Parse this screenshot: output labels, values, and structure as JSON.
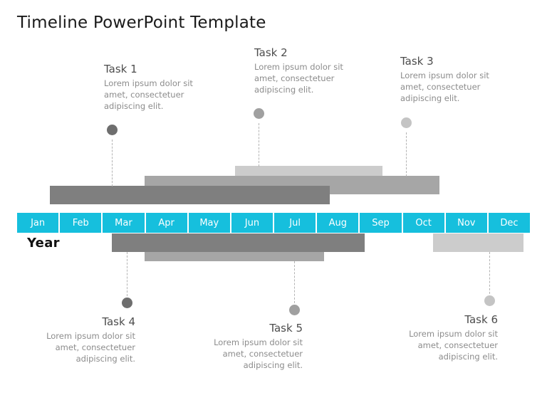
{
  "slide": {
    "title": "Timeline PowerPoint Template",
    "year_label": "Year",
    "background_color": "#ffffff"
  },
  "palette": {
    "accent": "#16bfdd",
    "bar_dark": "#7f7f7f",
    "bar_medium": "#a6a6a6",
    "bar_light": "#cccccc",
    "title_text": "#1a1a1a",
    "task_title_text": "#4d4d4d",
    "task_desc_text": "#8c8c8c",
    "connector": "#b3b3b3"
  },
  "timeline": {
    "months": [
      "Jan",
      "Feb",
      "Mar",
      "Apr",
      "May",
      "Jun",
      "Jul",
      "Aug",
      "Sep",
      "Oct",
      "Nov",
      "Dec"
    ]
  },
  "tasks": [
    {
      "id": "task-1",
      "title": "Task 1",
      "description": "Lorem ipsum dolor sit amet, consectetuer adipiscing elit.",
      "side": "above",
      "align": "left",
      "marker_color": "#6e6e6e"
    },
    {
      "id": "task-2",
      "title": "Task 2",
      "description": "Lorem ipsum dolor sit amet, consectetuer adipiscing elit.",
      "side": "above",
      "align": "left",
      "marker_color": "#a0a0a0"
    },
    {
      "id": "task-3",
      "title": "Task 3",
      "description": "Lorem ipsum dolor sit amet, consectetuer adipiscing elit.",
      "side": "above",
      "align": "left",
      "marker_color": "#c4c4c4"
    },
    {
      "id": "task-4",
      "title": "Task 4",
      "description": "Lorem ipsum dolor sit amet, consectetuer adipiscing elit.",
      "side": "below",
      "align": "right",
      "marker_color": "#6e6e6e"
    },
    {
      "id": "task-5",
      "title": "Task 5",
      "description": "Lorem ipsum dolor sit amet, consectetuer adipiscing elit.",
      "side": "below",
      "align": "right",
      "marker_color": "#a0a0a0"
    },
    {
      "id": "task-6",
      "title": "Task 6",
      "description": "Lorem ipsum dolor sit amet, consectetuer adipiscing elit.",
      "side": "below",
      "align": "right",
      "marker_color": "#c4c4c4"
    }
  ],
  "chart_data": {
    "type": "bar",
    "title": "Timeline PowerPoint Template",
    "xlabel": "Year",
    "ylabel": "",
    "categories": [
      "Jan",
      "Feb",
      "Mar",
      "Apr",
      "May",
      "Jun",
      "Jul",
      "Aug",
      "Sep",
      "Oct",
      "Nov",
      "Dec"
    ],
    "orientation": "horizontal",
    "grid": false,
    "legend": "none",
    "series": [
      {
        "name": "Task 1",
        "bar_color": "#7f7f7f",
        "start_month": "Feb",
        "end_month": "Jul",
        "row": "above-3",
        "marker_month": "Mar"
      },
      {
        "name": "Task 2",
        "bar_color": "#a6a6a6",
        "start_month": "Apr",
        "end_month": "Oct",
        "row": "above-2",
        "marker_month": "Jun"
      },
      {
        "name": "Task 3",
        "bar_color": "#cccccc",
        "start_month": "Jun",
        "end_month": "Sep",
        "row": "above-1",
        "marker_month": "Oct"
      },
      {
        "name": "Task 4",
        "bar_color": "#7f7f7f",
        "start_month": "Mar",
        "end_month": "Sep",
        "row": "below-1",
        "marker_month": "Mar"
      },
      {
        "name": "Task 5",
        "bar_color": "#a6a6a6",
        "start_month": "Apr",
        "end_month": "Aug",
        "row": "below-2",
        "marker_month": "Jul"
      },
      {
        "name": "Task 6",
        "bar_color": "#cccccc",
        "start_month": "Oct",
        "end_month": "Dec",
        "row": "below-1",
        "marker_month": "Nov"
      }
    ]
  }
}
